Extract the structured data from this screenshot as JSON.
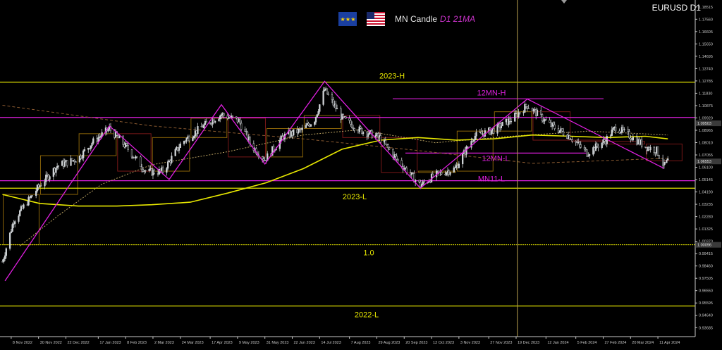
{
  "header": {
    "title": "MN Candle",
    "subtitle": "D1 21MA",
    "symbol": "EURUSD D1",
    "flags": [
      "eu-flag-icon",
      "us-flag-icon"
    ]
  },
  "colors": {
    "background": "#000000",
    "candle": "#cfd3d6",
    "level_line": "#e6e600",
    "zigzag": "#e01fe0",
    "ma_slow": "#e8e800",
    "ma_mid": "#b8a060",
    "ma_long": "#8a5a30",
    "monthly_box_up": "#b8860b",
    "monthly_box_down": "#a02020",
    "grid_cross": "#b8a050",
    "axis": "#c8c8c8"
  },
  "chart_data": {
    "type": "candlestick",
    "title": "MN Candle D1 21MA",
    "symbol": "EURUSD D1",
    "ylim": [
      0.9299,
      1.1905
    ],
    "x_tick_labels": [
      "8 Nov 2022",
      "30 Nov 2022",
      "22 Dec 2022",
      "17 Jan 2023",
      "8 Feb 2023",
      "2 Mar 2023",
      "24 Mar 2023",
      "17 Apr 2023",
      "9 May 2023",
      "31 May 2023",
      "22 Jun 2023",
      "14 Jul 2023",
      "7 Aug 2023",
      "29 Aug 2023",
      "20 Sep 2023",
      "12 Oct 2023",
      "3 Nov 2023",
      "27 Nov 2023",
      "19 Dec 2023",
      "12 Jan 2024",
      "5 Feb 2024",
      "27 Feb 2024",
      "20 Mar 2024",
      "11 Apr 2024"
    ],
    "y_tick_labels": [
      "1.18515",
      "1.17560",
      "1.16605",
      "1.15650",
      "1.14695",
      "1.13740",
      "1.12785",
      "1.11830",
      "1.10875",
      "1.09920",
      "1.08965",
      "1.08010",
      "1.07055",
      "1.06100",
      "1.05145",
      "1.04190",
      "1.03235",
      "1.02280",
      "1.01325",
      "1.00370",
      "0.99415",
      "0.98460",
      "0.97505",
      "0.96550",
      "0.95595",
      "0.94640",
      "0.93685"
    ],
    "current_price_label": "1.06553",
    "cursor_price_label": "1.09503",
    "level_price_label": "1.00096",
    "levels": [
      {
        "label": "2023-H",
        "price": 1.1269
      },
      {
        "label": "12MN-H",
        "price": 1.114
      },
      {
        "label": "",
        "price": 1.0996
      },
      {
        "label": "12MN-L",
        "price": 1.072
      },
      {
        "label": "MN11-L",
        "price": 1.0506
      },
      {
        "label": "2023-L",
        "price": 1.0448
      },
      {
        "label": "1.0",
        "price": 1.001
      },
      {
        "label": "2022-L",
        "price": 0.9536
      }
    ],
    "zigzag": [
      {
        "date": "2022-11-03",
        "price": 0.973
      },
      {
        "date": "2023-01-26",
        "price": 1.093
      },
      {
        "date": "2023-03-15",
        "price": 1.0516
      },
      {
        "date": "2023-04-26",
        "price": 1.1095
      },
      {
        "date": "2023-05-31",
        "price": 1.0635
      },
      {
        "date": "2023-07-18",
        "price": 1.1276
      },
      {
        "date": "2023-10-03",
        "price": 1.0448
      },
      {
        "date": "2023-12-28",
        "price": 1.1139
      },
      {
        "date": "2024-04-16",
        "price": 1.0601
      }
    ],
    "series": [
      {
        "key": "price",
        "values": [
          [
            "2022-11-01",
            0.988
          ],
          [
            "2022-11-10",
            1.02
          ],
          [
            "2022-11-20",
            1.033
          ],
          [
            "2022-12-01",
            1.047
          ],
          [
            "2022-12-15",
            1.062
          ],
          [
            "2023-01-01",
            1.068
          ],
          [
            "2023-01-12",
            1.08
          ],
          [
            "2023-01-26",
            1.091
          ],
          [
            "2023-02-10",
            1.075
          ],
          [
            "2023-02-25",
            1.057
          ],
          [
            "2023-03-10",
            1.058
          ],
          [
            "2023-03-25",
            1.08
          ],
          [
            "2023-04-10",
            1.092
          ],
          [
            "2023-04-26",
            1.102
          ],
          [
            "2023-05-10",
            1.097
          ],
          [
            "2023-05-20",
            1.078
          ],
          [
            "2023-05-31",
            1.067
          ],
          [
            "2023-06-15",
            1.085
          ],
          [
            "2023-06-30",
            1.09
          ],
          [
            "2023-07-10",
            1.098
          ],
          [
            "2023-07-18",
            1.121
          ],
          [
            "2023-08-01",
            1.099
          ],
          [
            "2023-08-15",
            1.09
          ],
          [
            "2023-08-31",
            1.084
          ],
          [
            "2023-09-15",
            1.066
          ],
          [
            "2023-10-03",
            1.047
          ],
          [
            "2023-10-15",
            1.055
          ],
          [
            "2023-10-31",
            1.06
          ],
          [
            "2023-11-15",
            1.085
          ],
          [
            "2023-12-01",
            1.09
          ],
          [
            "2023-12-15",
            1.098
          ],
          [
            "2023-12-28",
            1.109
          ],
          [
            "2024-01-15",
            1.094
          ],
          [
            "2024-01-31",
            1.085
          ],
          [
            "2024-02-14",
            1.072
          ],
          [
            "2024-02-29",
            1.082
          ],
          [
            "2024-03-08",
            1.092
          ],
          [
            "2024-03-20",
            1.085
          ],
          [
            "2024-04-01",
            1.077
          ],
          [
            "2024-04-10",
            1.074
          ],
          [
            "2024-04-16",
            1.062
          ],
          [
            "2024-04-19",
            1.066
          ]
        ]
      },
      {
        "key": "ma_slow",
        "values": [
          [
            "2022-11-01",
            1.04
          ],
          [
            "2022-12-01",
            1.033
          ],
          [
            "2023-01-01",
            1.031
          ],
          [
            "2023-02-01",
            1.031
          ],
          [
            "2023-03-01",
            1.032
          ],
          [
            "2023-04-01",
            1.034
          ],
          [
            "2023-05-01",
            1.041
          ],
          [
            "2023-06-01",
            1.049
          ],
          [
            "2023-07-01",
            1.06
          ],
          [
            "2023-08-01",
            1.075
          ],
          [
            "2023-09-01",
            1.082
          ],
          [
            "2023-10-01",
            1.084
          ],
          [
            "2023-11-01",
            1.082
          ],
          [
            "2023-12-01",
            1.083
          ],
          [
            "2024-01-01",
            1.086
          ],
          [
            "2024-02-01",
            1.085
          ],
          [
            "2024-03-01",
            1.084
          ],
          [
            "2024-04-01",
            1.085
          ],
          [
            "2024-04-19",
            1.083
          ]
        ]
      },
      {
        "key": "ma_mid",
        "values": [
          [
            "2022-11-15",
            1.0
          ],
          [
            "2022-12-15",
            1.023
          ],
          [
            "2023-01-20",
            1.048
          ],
          [
            "2023-03-01",
            1.063
          ],
          [
            "2023-05-01",
            1.073
          ],
          [
            "2023-07-01",
            1.086
          ],
          [
            "2023-08-15",
            1.09
          ],
          [
            "2023-10-15",
            1.08
          ],
          [
            "2023-12-15",
            1.085
          ],
          [
            "2024-02-15",
            1.089
          ],
          [
            "2024-04-19",
            1.086
          ]
        ]
      },
      {
        "key": "ma_long",
        "values": [
          [
            "2022-11-01",
            1.109
          ],
          [
            "2023-03-01",
            1.093
          ],
          [
            "2023-07-01",
            1.083
          ],
          [
            "2023-10-01",
            1.074
          ],
          [
            "2024-01-01",
            1.064
          ],
          [
            "2024-04-19",
            1.068
          ]
        ]
      }
    ],
    "monthly_boxes": [
      {
        "month": "2022-11",
        "open": 1.001,
        "close": 1.04,
        "high": 1.049,
        "low": 1.0
      },
      {
        "month": "2022-12",
        "open": 1.04,
        "close": 1.07,
        "high": 1.074,
        "low": 1.035
      },
      {
        "month": "2023-01",
        "open": 1.07,
        "close": 1.087,
        "high": 1.093,
        "low": 1.049
      },
      {
        "month": "2023-02",
        "open": 1.087,
        "close": 1.058,
        "high": 1.08,
        "low": 1.053
      },
      {
        "month": "2023-03",
        "open": 1.058,
        "close": 1.084,
        "high": 1.093,
        "low": 1.052
      },
      {
        "month": "2023-04",
        "open": 1.084,
        "close": 1.099,
        "high": 1.106,
        "low": 1.077
      },
      {
        "month": "2023-05",
        "open": 1.099,
        "close": 1.069,
        "high": 1.103,
        "low": 1.063
      },
      {
        "month": "2023-06",
        "open": 1.069,
        "close": 1.091,
        "high": 1.096,
        "low": 1.066
      },
      {
        "month": "2023-07",
        "open": 1.091,
        "close": 1.101,
        "high": 1.127,
        "low": 1.088
      },
      {
        "month": "2023-08",
        "open": 1.101,
        "close": 1.084,
        "high": 1.103,
        "low": 1.076
      },
      {
        "month": "2023-09",
        "open": 1.084,
        "close": 1.057,
        "high": 1.087,
        "low": 1.049
      },
      {
        "month": "2023-10",
        "open": 1.057,
        "close": 1.058,
        "high": 1.069,
        "low": 1.045
      },
      {
        "month": "2023-11",
        "open": 1.058,
        "close": 1.089,
        "high": 1.101,
        "low": 1.055
      },
      {
        "month": "2023-12",
        "open": 1.089,
        "close": 1.104,
        "high": 1.114,
        "low": 1.072
      },
      {
        "month": "2024-01",
        "open": 1.104,
        "close": 1.082,
        "high": 1.104,
        "low": 1.079
      },
      {
        "month": "2024-02",
        "open": 1.082,
        "close": 1.081,
        "high": 1.09,
        "low": 1.07
      },
      {
        "month": "2024-03",
        "open": 1.081,
        "close": 1.079,
        "high": 1.096,
        "low": 1.076
      },
      {
        "month": "2024-04",
        "open": 1.079,
        "close": 1.066,
        "high": 1.089,
        "low": 1.06
      }
    ],
    "cursor_date": "2023-12-20"
  }
}
